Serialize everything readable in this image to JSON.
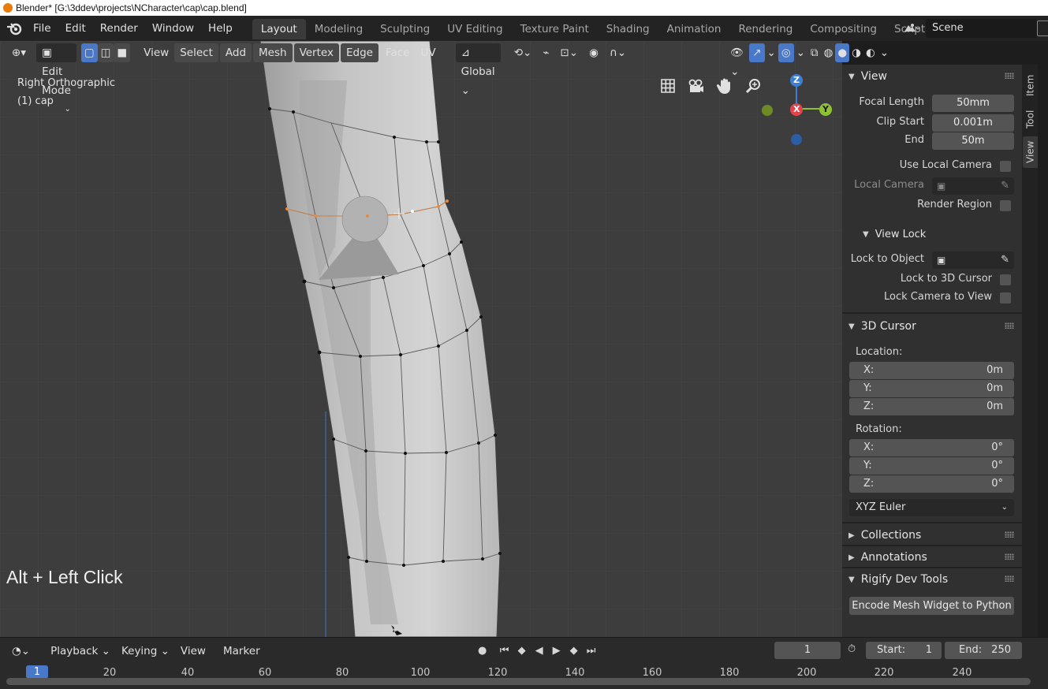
{
  "os_title": "Blender* [G:\\3ddev\\projects\\NCharacter\\cap\\cap.blend]",
  "menu": [
    "File",
    "Edit",
    "Render",
    "Window",
    "Help"
  ],
  "workspaces": [
    "Layout",
    "Modeling",
    "Sculpting",
    "UV Editing",
    "Texture Paint",
    "Shading",
    "Animation",
    "Rendering",
    "Compositing",
    "Scripting"
  ],
  "scene": "Scene",
  "viewport_header": {
    "mode": "Edit Mode",
    "menus": [
      "View",
      "Select",
      "Add",
      "Mesh",
      "Vertex",
      "Edge",
      "Face",
      "UV"
    ],
    "orientation": "Global"
  },
  "viewport": {
    "view_name": "Right Orthographic",
    "object_name": "(1) cap",
    "hint": "Alt + Left Click",
    "gizmo_axes": {
      "z": "Z",
      "x": "X",
      "y": "Y"
    }
  },
  "sidebar": {
    "tabs": [
      "Item",
      "Tool",
      "View"
    ],
    "view_panel": {
      "title": "View",
      "focal_length_label": "Focal Length",
      "focal_length": "50mm",
      "clip_start_label": "Clip Start",
      "clip_start": "0.001m",
      "end_label": "End",
      "end": "50m",
      "use_local_camera": "Use Local Camera",
      "local_camera": "Local Camera",
      "render_region": "Render Region"
    },
    "view_lock": {
      "title": "View Lock",
      "lock_to_object": "Lock to Object",
      "lock_to_3d_cursor": "Lock to 3D Cursor",
      "lock_camera_to_view": "Lock Camera to View"
    },
    "cursor_panel": {
      "title": "3D Cursor",
      "location_label": "Location:",
      "location": [
        {
          "axis": "X:",
          "value": "0m"
        },
        {
          "axis": "Y:",
          "value": "0m"
        },
        {
          "axis": "Z:",
          "value": "0m"
        }
      ],
      "rotation_label": "Rotation:",
      "rotation": [
        {
          "axis": "X:",
          "value": "0°"
        },
        {
          "axis": "Y:",
          "value": "0°"
        },
        {
          "axis": "Z:",
          "value": "0°"
        }
      ],
      "rotation_mode": "XYZ Euler"
    },
    "collections": "Collections",
    "annotations": "Annotations",
    "rigify": {
      "title": "Rigify Dev Tools",
      "button": "Encode Mesh Widget to Python"
    }
  },
  "timeline": {
    "menus": [
      "Playback",
      "Keying",
      "View",
      "Marker"
    ],
    "current_frame": "1",
    "start_label": "Start:",
    "start": "1",
    "end_label": "End:",
    "end": "250",
    "ruler_ticks": [
      "20",
      "40",
      "60",
      "80",
      "100",
      "120",
      "140",
      "160",
      "180",
      "200",
      "220",
      "240"
    ],
    "ruler_current": "1"
  },
  "colors": {
    "accent": "#4a78c8",
    "selected_vertex": "#e8893c",
    "axis_x": "#e2444a",
    "axis_y": "#8fc232",
    "axis_z": "#3c7fd6"
  }
}
